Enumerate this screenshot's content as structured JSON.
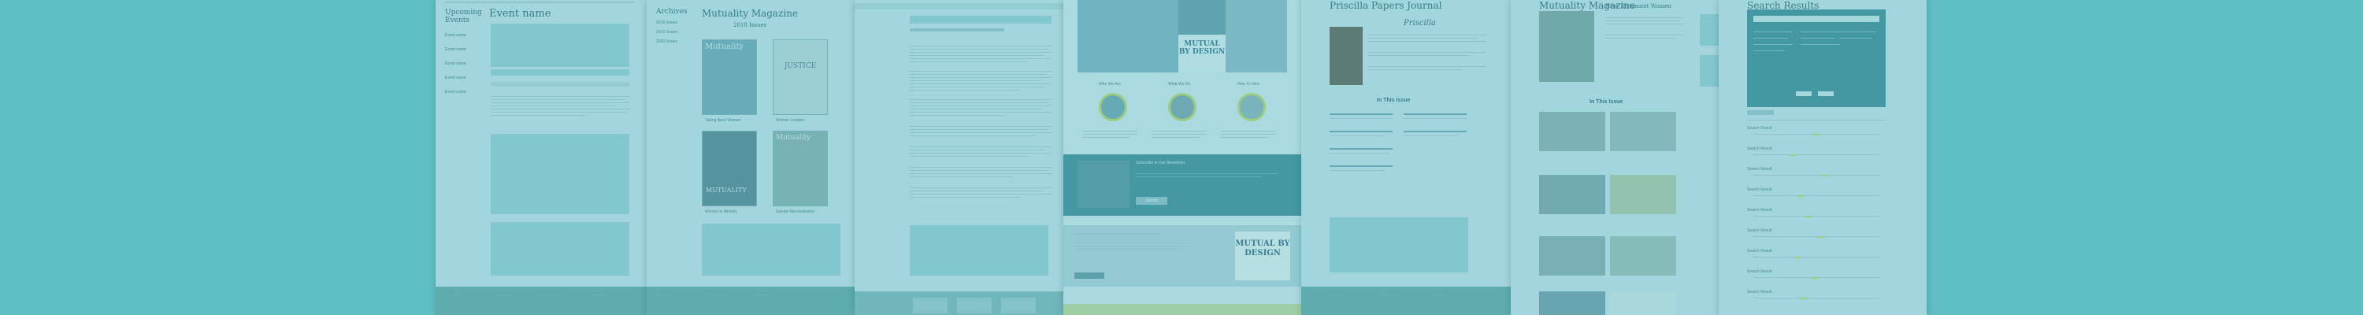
{
  "card1": {
    "sidebar_title": "Upcoming Events",
    "event_title": "Event name",
    "side_items": [
      "Event name",
      "Event name",
      "Event name",
      "Event name",
      "Event name"
    ]
  },
  "card2": {
    "sidebar_title": "Archives",
    "side_items": [
      "2018 Issues",
      "2019 Issues",
      "2020 Issues"
    ],
    "title": "Mutuality Magazine",
    "subtitle": "2018 Issues",
    "cover_titles": [
      "Mutuality",
      "JUSTICE",
      "MUTUALITY",
      "Mutuality"
    ],
    "cover_captions": [
      "Taking Back Women",
      "Women Leaders",
      "Women in Ministry",
      "Gender Reconciliation"
    ]
  },
  "card4": {
    "banner_text": "MUTUAL BY DESIGN",
    "col_titles": [
      "Who We Are",
      "What We Do",
      "How To Give"
    ],
    "cta_title": "Subscribe to Our Newsletter",
    "cta_button": "Submit",
    "bottom_banner": "MUTUAL BY DESIGN"
  },
  "card5": {
    "title": "Priscilla Papers Journal",
    "logo_text": "Priscilla",
    "section": "In This Issue"
  },
  "card6": {
    "title": "Mutuality Magazine",
    "article_title": "New Testament Women",
    "section": "In This Issue"
  },
  "card7": {
    "title": "Search Results",
    "results": [
      "Search Result",
      "Search Result",
      "Search Result",
      "Search Result",
      "Search Result",
      "Search Result",
      "Search Result",
      "Search Result",
      "Search Result"
    ]
  },
  "colors": {
    "background": "#5ec0c4",
    "footer": "#5e9f9c",
    "accent": "#c8d84a",
    "panel": "#2f7d86"
  }
}
